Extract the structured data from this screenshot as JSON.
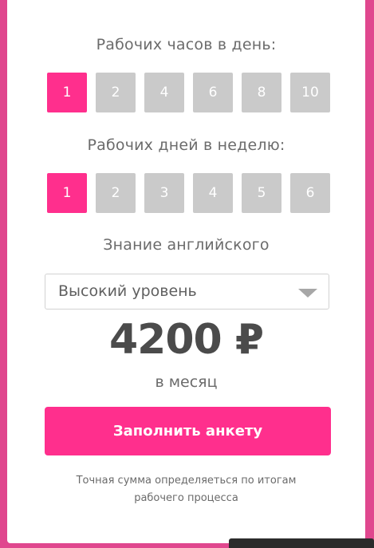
{
  "hours": {
    "label": "Рабочих часов в день:",
    "options": [
      "1",
      "2",
      "4",
      "6",
      "8",
      "10"
    ],
    "selected": "1"
  },
  "days": {
    "label": "Рабочих дней в неделю:",
    "options": [
      "1",
      "2",
      "3",
      "4",
      "5",
      "6"
    ],
    "selected": "1"
  },
  "english": {
    "label": "Знание английского",
    "selected_value": "Высокий уровень"
  },
  "price": {
    "amount": "4200 ₽",
    "period": "в месяц"
  },
  "cta": {
    "label": "Заполнить анкету"
  },
  "note": {
    "text": "Точная сумма определяеться по итогам рабочего процесса"
  },
  "colors": {
    "accent": "#ff2f8d",
    "inactive": "#cacaca",
    "background": "#e0478e"
  }
}
